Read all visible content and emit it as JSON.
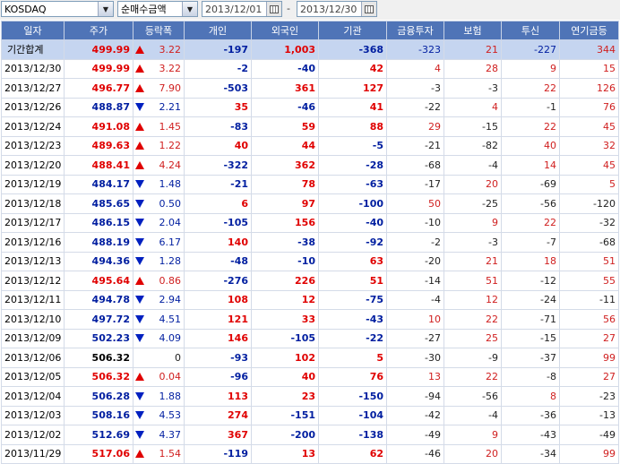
{
  "toolbar": {
    "market": "KOSDAQ",
    "investor_type": "순매수금액",
    "start_date": "2013/12/01",
    "separator": "-",
    "end_date": "2013/12/30"
  },
  "columns": [
    "일자",
    "주가",
    "등락폭",
    "개인",
    "외국인",
    "기관",
    "금융투자",
    "보험",
    "투신",
    "연기금등"
  ],
  "summary": {
    "label": "기간합계",
    "price": "499.99",
    "dir": "up",
    "change": "3.22",
    "individual": "-197",
    "foreign": "1,003",
    "institution": "-368",
    "financial": "-323",
    "insurance": "21",
    "trust": "-227",
    "pension": "344"
  },
  "rows": [
    {
      "date": "2013/12/30",
      "price": "499.99",
      "dir": "up",
      "change": "3.22",
      "individual": "-2",
      "foreign": "-40",
      "institution": "42",
      "financial": "4",
      "insurance": "28",
      "trust": "9",
      "pension": "15"
    },
    {
      "date": "2013/12/27",
      "price": "496.77",
      "dir": "up",
      "change": "7.90",
      "individual": "-503",
      "foreign": "361",
      "institution": "127",
      "financial": "-3",
      "insurance": "-3",
      "trust": "22",
      "pension": "126"
    },
    {
      "date": "2013/12/26",
      "price": "488.87",
      "dir": "down",
      "change": "2.21",
      "individual": "35",
      "foreign": "-46",
      "institution": "41",
      "financial": "-22",
      "insurance": "4",
      "trust": "-1",
      "pension": "76"
    },
    {
      "date": "2013/12/24",
      "price": "491.08",
      "dir": "up",
      "change": "1.45",
      "individual": "-83",
      "foreign": "59",
      "institution": "88",
      "financial": "29",
      "insurance": "-15",
      "trust": "22",
      "pension": "45"
    },
    {
      "date": "2013/12/23",
      "price": "489.63",
      "dir": "up",
      "change": "1.22",
      "individual": "40",
      "foreign": "44",
      "institution": "-5",
      "financial": "-21",
      "insurance": "-82",
      "trust": "40",
      "pension": "32"
    },
    {
      "date": "2013/12/20",
      "price": "488.41",
      "dir": "up",
      "change": "4.24",
      "individual": "-322",
      "foreign": "362",
      "institution": "-28",
      "financial": "-68",
      "insurance": "-4",
      "trust": "14",
      "pension": "45"
    },
    {
      "date": "2013/12/19",
      "price": "484.17",
      "dir": "down",
      "change": "1.48",
      "individual": "-21",
      "foreign": "78",
      "institution": "-63",
      "financial": "-17",
      "insurance": "20",
      "trust": "-69",
      "pension": "5"
    },
    {
      "date": "2013/12/18",
      "price": "485.65",
      "dir": "down",
      "change": "0.50",
      "individual": "6",
      "foreign": "97",
      "institution": "-100",
      "financial": "50",
      "insurance": "-25",
      "trust": "-56",
      "pension": "-120"
    },
    {
      "date": "2013/12/17",
      "price": "486.15",
      "dir": "down",
      "change": "2.04",
      "individual": "-105",
      "foreign": "156",
      "institution": "-40",
      "financial": "-10",
      "insurance": "9",
      "trust": "22",
      "pension": "-32"
    },
    {
      "date": "2013/12/16",
      "price": "488.19",
      "dir": "down",
      "change": "6.17",
      "individual": "140",
      "foreign": "-38",
      "institution": "-92",
      "financial": "-2",
      "insurance": "-3",
      "trust": "-7",
      "pension": "-68"
    },
    {
      "date": "2013/12/13",
      "price": "494.36",
      "dir": "down",
      "change": "1.28",
      "individual": "-48",
      "foreign": "-10",
      "institution": "63",
      "financial": "-20",
      "insurance": "21",
      "trust": "18",
      "pension": "51"
    },
    {
      "date": "2013/12/12",
      "price": "495.64",
      "dir": "up",
      "change": "0.86",
      "individual": "-276",
      "foreign": "226",
      "institution": "51",
      "financial": "-14",
      "insurance": "51",
      "trust": "-12",
      "pension": "55"
    },
    {
      "date": "2013/12/11",
      "price": "494.78",
      "dir": "down",
      "change": "2.94",
      "individual": "108",
      "foreign": "12",
      "institution": "-75",
      "financial": "-4",
      "insurance": "12",
      "trust": "-24",
      "pension": "-11"
    },
    {
      "date": "2013/12/10",
      "price": "497.72",
      "dir": "down",
      "change": "4.51",
      "individual": "121",
      "foreign": "33",
      "institution": "-43",
      "financial": "10",
      "insurance": "22",
      "trust": "-71",
      "pension": "56"
    },
    {
      "date": "2013/12/09",
      "price": "502.23",
      "dir": "down",
      "change": "4.09",
      "individual": "146",
      "foreign": "-105",
      "institution": "-22",
      "financial": "-27",
      "insurance": "25",
      "trust": "-15",
      "pension": "27"
    },
    {
      "date": "2013/12/06",
      "price": "506.32",
      "dir": "none",
      "change": "0",
      "individual": "-93",
      "foreign": "102",
      "institution": "5",
      "financial": "-30",
      "insurance": "-9",
      "trust": "-37",
      "pension": "99"
    },
    {
      "date": "2013/12/05",
      "price": "506.32",
      "dir": "up",
      "change": "0.04",
      "individual": "-96",
      "foreign": "40",
      "institution": "76",
      "financial": "13",
      "insurance": "22",
      "trust": "-8",
      "pension": "27"
    },
    {
      "date": "2013/12/04",
      "price": "506.28",
      "dir": "down",
      "change": "1.88",
      "individual": "113",
      "foreign": "23",
      "institution": "-150",
      "financial": "-94",
      "insurance": "-56",
      "trust": "8",
      "pension": "-23"
    },
    {
      "date": "2013/12/03",
      "price": "508.16",
      "dir": "down",
      "change": "4.53",
      "individual": "274",
      "foreign": "-151",
      "institution": "-104",
      "financial": "-42",
      "insurance": "-4",
      "trust": "-36",
      "pension": "-13"
    },
    {
      "date": "2013/12/02",
      "price": "512.69",
      "dir": "down",
      "change": "4.37",
      "individual": "367",
      "foreign": "-200",
      "institution": "-138",
      "financial": "-49",
      "insurance": "9",
      "trust": "-43",
      "pension": "-49"
    },
    {
      "date": "2013/11/29",
      "price": "517.06",
      "dir": "up",
      "change": "1.54",
      "individual": "-119",
      "foreign": "13",
      "institution": "62",
      "financial": "-46",
      "insurance": "20",
      "trust": "-34",
      "pension": "99"
    }
  ],
  "colors": {
    "header_bg": "#4f74b7",
    "summary_bg": "#c5d5f0",
    "up": "#e00000",
    "down": "#001ea0"
  }
}
